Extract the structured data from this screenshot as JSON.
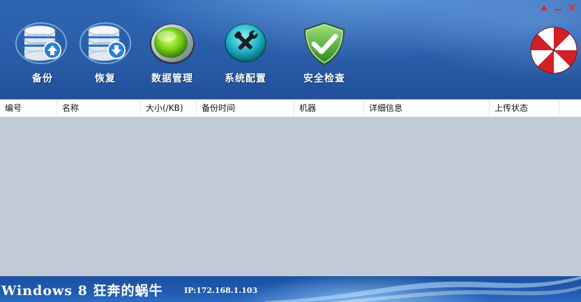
{
  "toolbar": {
    "backup": {
      "label": "备份",
      "icon": "database-upload-icon"
    },
    "restore": {
      "label": "恢复",
      "icon": "database-download-icon"
    },
    "data_manage": {
      "label": "数据管理",
      "icon": "green-orb-icon"
    },
    "system_config": {
      "label": "系统配置",
      "icon": "tools-icon"
    },
    "security_check": {
      "label": "安全检查",
      "icon": "shield-check-icon"
    }
  },
  "table": {
    "columns": [
      "编号",
      "名称",
      "大小(/KB)",
      "备份时间",
      "机器",
      "详细信息",
      "上传状态"
    ],
    "rows": []
  },
  "footer": {
    "title": "Windows 8 狂奔的蜗牛",
    "ip": "IP:172.168.1.103"
  },
  "colors": {
    "header_bg": "#2a5da8",
    "table_bg": "#c0cbd7",
    "accent_red": "#d32a2a"
  }
}
